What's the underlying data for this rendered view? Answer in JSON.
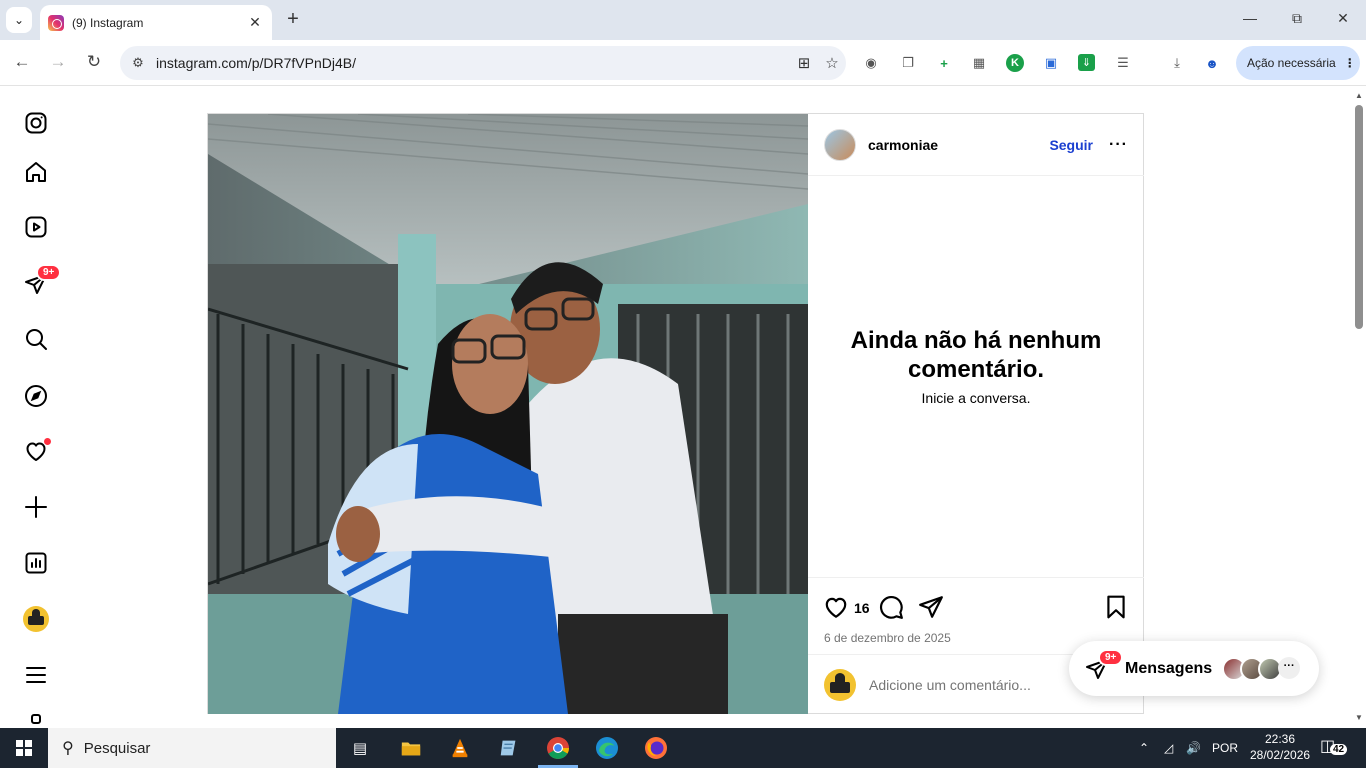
{
  "browser": {
    "tab_title": "(9) Instagram",
    "url": "instagram.com/p/DR7fVPnDj4B/",
    "action_needed": "Ação necessária"
  },
  "nav": {
    "notifications_badge": "9+"
  },
  "post": {
    "username": "carmoniae",
    "follow_label": "Seguir",
    "empty_title": "Ainda não há nenhum comentário.",
    "empty_subtitle": "Inicie a conversa.",
    "likes": "16",
    "date": "6 de dezembro de 2025",
    "comment_placeholder": "Adicione um comentário..."
  },
  "messages": {
    "label": "Mensagens",
    "badge": "9+"
  },
  "taskbar": {
    "search_placeholder": "Pesquisar",
    "language": "POR",
    "time": "22:36",
    "date": "28/02/2026",
    "notification_count": "42"
  },
  "colors": {
    "follow_blue": "#1a3fd0",
    "badge_red": "#ff3040",
    "taskbar": "#1c2530"
  }
}
